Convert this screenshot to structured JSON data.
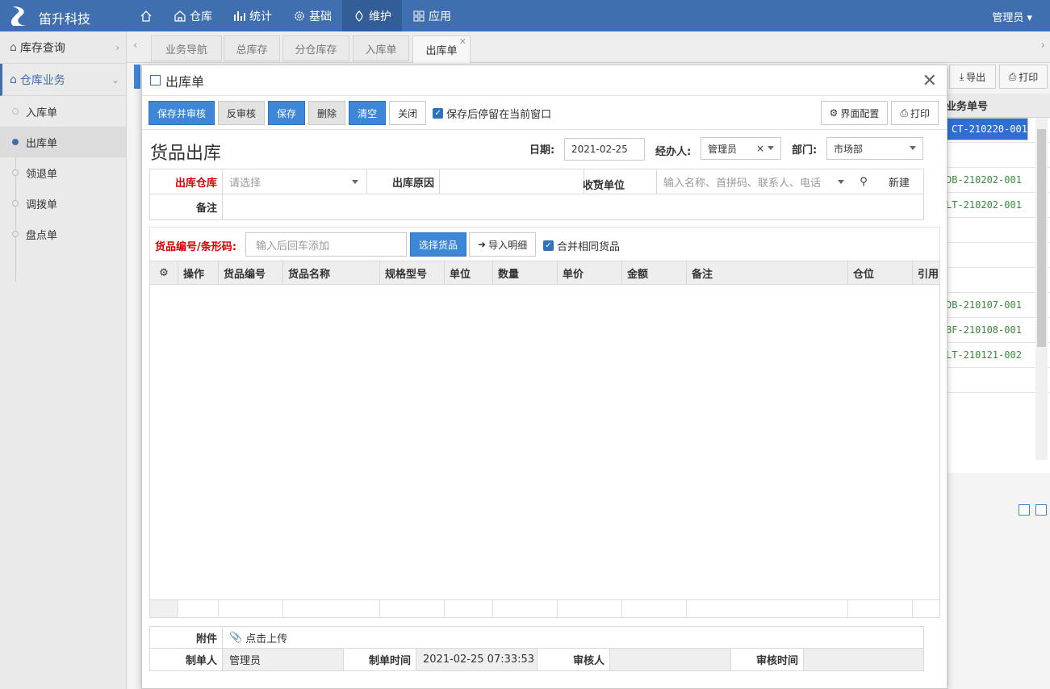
{
  "app": {
    "brand": "笛升科技",
    "user": "管理员"
  },
  "nav": [
    {
      "label": "仓库",
      "icon": "warehouse-icon"
    },
    {
      "label": "统计",
      "icon": "bar-chart-icon"
    },
    {
      "label": "基础",
      "icon": "gear-icon"
    },
    {
      "label": "维护",
      "icon": "maintenance-icon"
    },
    {
      "label": "应用",
      "icon": "grid-icon"
    }
  ],
  "sidebar": {
    "group1": "库存查询",
    "group2": "仓库业务",
    "items": [
      "入库单",
      "出库单",
      "领退单",
      "调拨单",
      "盘点单"
    ]
  },
  "tabs": [
    "业务导航",
    "总库存",
    "分仓库存",
    "入库单",
    "出库单"
  ],
  "background": {
    "export_label": "导出",
    "print_label": "打印",
    "column": "业务单号",
    "rows": [
      "CT-210220-001",
      "",
      "",
      "DB-210202-001",
      "LT-210202-001",
      "",
      "",
      "",
      "DB-210107-001",
      "BF-210108-001",
      "LT-210121-002",
      ""
    ]
  },
  "modal": {
    "title": "出库单",
    "toolbar": {
      "save_audit": "保存并审核",
      "unaudit": "反审核",
      "save": "保存",
      "delete": "删除",
      "clear": "清空",
      "close": "关闭",
      "stay_label": "保存后停留在当前窗口",
      "ui_config": "界面配置",
      "print": "打印"
    },
    "doc_title": "货品出库",
    "date_label": "日期:",
    "date_value": "2021-02-25",
    "handler_label": "经办人:",
    "handler_value": "管理员",
    "dept_label": "部门:",
    "dept_value": "市场部",
    "form": {
      "warehouse_label": "出库仓库",
      "warehouse_placeholder": "请选择",
      "reason_label": "出库原因",
      "reason_value": "",
      "receiver_label": "收货单位",
      "receiver_placeholder": "输入名称、首拼码、联系人、电话",
      "new_label": "新建",
      "remark_label": "备注",
      "remark_value": ""
    },
    "add": {
      "label": "货品编号/条形码:",
      "placeholder": "输入后回车添加",
      "select_btn": "选择货品",
      "import_btn": "导入明细",
      "merge_label": "合并相同货品"
    },
    "grid_columns": [
      "操作",
      "货品编号",
      "货品名称",
      "规格型号",
      "单位",
      "数量",
      "单价",
      "金额",
      "备注",
      "仓位",
      "引用"
    ],
    "footer": {
      "attach_label": "附件",
      "upload_label": "点击上传",
      "creator_label": "制单人",
      "creator_value": "管理员",
      "created_label": "制单时间",
      "created_value": "2021-02-25 07:33:53",
      "auditor_label": "审核人",
      "auditor_value": "",
      "audit_time_label": "审核时间",
      "audit_time_value": ""
    }
  },
  "colors": {
    "topbar": "#3f6fae",
    "primary_button": "#3d86d8",
    "required_label": "#d60000",
    "selected_row": "#2f6fd3"
  }
}
